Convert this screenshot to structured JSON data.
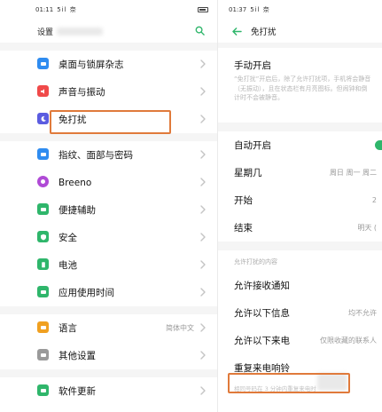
{
  "left_screen": {
    "status": {
      "time": "01:11",
      "signal": "5il 奈"
    },
    "header": {
      "title": "设置"
    },
    "items": [
      {
        "label": "桌面与锁屏杂志",
        "icon": "wallpaper-icon",
        "color": "#2f8cf0"
      },
      {
        "label": "声音与振动",
        "icon": "sound-icon",
        "color": "#f04a4a"
      },
      {
        "label": "免打扰",
        "icon": "moon-icon",
        "color": "#5b5ce0"
      },
      {
        "label": "指纹、面部与密码",
        "icon": "fingerprint-icon",
        "color": "#2f8cf0"
      },
      {
        "label": "Breeno",
        "icon": "breeno-icon",
        "color": "#b04ad6"
      },
      {
        "label": "便捷辅助",
        "icon": "assist-icon",
        "color": "#2fb66b"
      },
      {
        "label": "安全",
        "icon": "shield-icon",
        "color": "#2fb66b"
      },
      {
        "label": "电池",
        "icon": "battery-icon",
        "color": "#2fb66b"
      },
      {
        "label": "应用使用时间",
        "icon": "app-time-icon",
        "color": "#2fb66b"
      },
      {
        "label": "语言",
        "value": "简体中文",
        "icon": "language-icon",
        "color": "#f0a020"
      },
      {
        "label": "其他设置",
        "icon": "other-settings-icon",
        "color": "#9a9a9a"
      },
      {
        "label": "软件更新",
        "icon": "update-icon",
        "color": "#2fb66b"
      }
    ]
  },
  "right_screen": {
    "status": {
      "time": "01:37",
      "signal": "5il 奈"
    },
    "header": {
      "title": "免打扰"
    },
    "manual": {
      "title": "手动开启",
      "description": "“免打扰”开启后，除了允许打扰项，手机将会静音（无振动），且在状态栏有月亮图标。但闹钟和倒计时不会被静音。"
    },
    "schedule": [
      {
        "label": "自动开启",
        "value": ""
      },
      {
        "label": "星期几",
        "value": "周日 周一 周二"
      },
      {
        "label": "开始",
        "value": "2"
      },
      {
        "label": "结束",
        "value": "明天 ("
      }
    ],
    "allow_caption": "允许打扰的内容",
    "allow": [
      {
        "label": "允许接收通知",
        "value": ""
      },
      {
        "label": "允许以下信息",
        "value": "均不允许"
      },
      {
        "label": "允许以下来电",
        "value": "仅限收藏的联系人"
      },
      {
        "label": "重复来电响铃",
        "value": ""
      }
    ],
    "repeat_note": "相同号码在 3 分钟内重复来电时"
  },
  "colors": {
    "highlight": "#e07a3b",
    "toggle_on": "#2fb66b"
  }
}
